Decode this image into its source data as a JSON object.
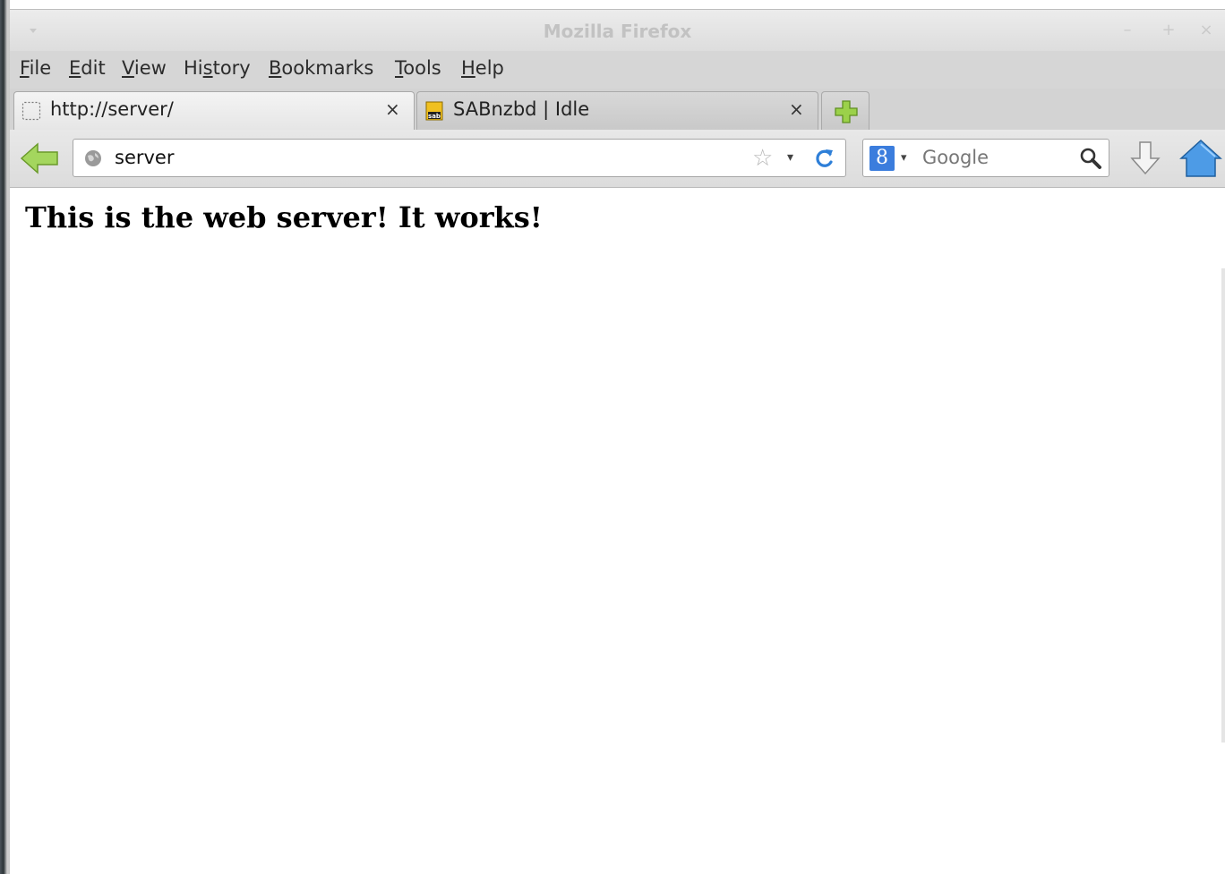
{
  "window": {
    "title": "Mozilla Firefox",
    "minimize_glyph": "–",
    "maximize_glyph": "+",
    "close_glyph": "×"
  },
  "menubar": {
    "items": [
      {
        "label_accel": "F",
        "label_rest": "ile"
      },
      {
        "label_accel": "E",
        "label_rest": "dit"
      },
      {
        "label_accel": "V",
        "label_rest": "iew"
      },
      {
        "label_pre": "Hi",
        "label_accel": "s",
        "label_rest": "tory"
      },
      {
        "label_accel": "B",
        "label_rest": "ookmarks"
      },
      {
        "label_accel": "T",
        "label_rest": "ools"
      },
      {
        "label_accel": "H",
        "label_rest": "elp"
      }
    ]
  },
  "tabs": [
    {
      "label": "http://server/",
      "close": "×",
      "active": true,
      "icon": "blank-page-icon"
    },
    {
      "label": "SABnzbd | Idle",
      "close": "×",
      "active": false,
      "icon": "sabnzbd-icon"
    }
  ],
  "navbar": {
    "url_value": "server",
    "search_placeholder": "Google",
    "star_glyph": "☆",
    "dropdown_glyph": "▾",
    "search_engine_glyph": "8"
  },
  "content": {
    "heading": "This is the web server! It works!"
  },
  "colors": {
    "accent_green": "#8dc63f",
    "search_engine_blue": "#3b7ddd",
    "home_blue": "#3a8ad8",
    "reload_blue": "#2e7fd8"
  }
}
